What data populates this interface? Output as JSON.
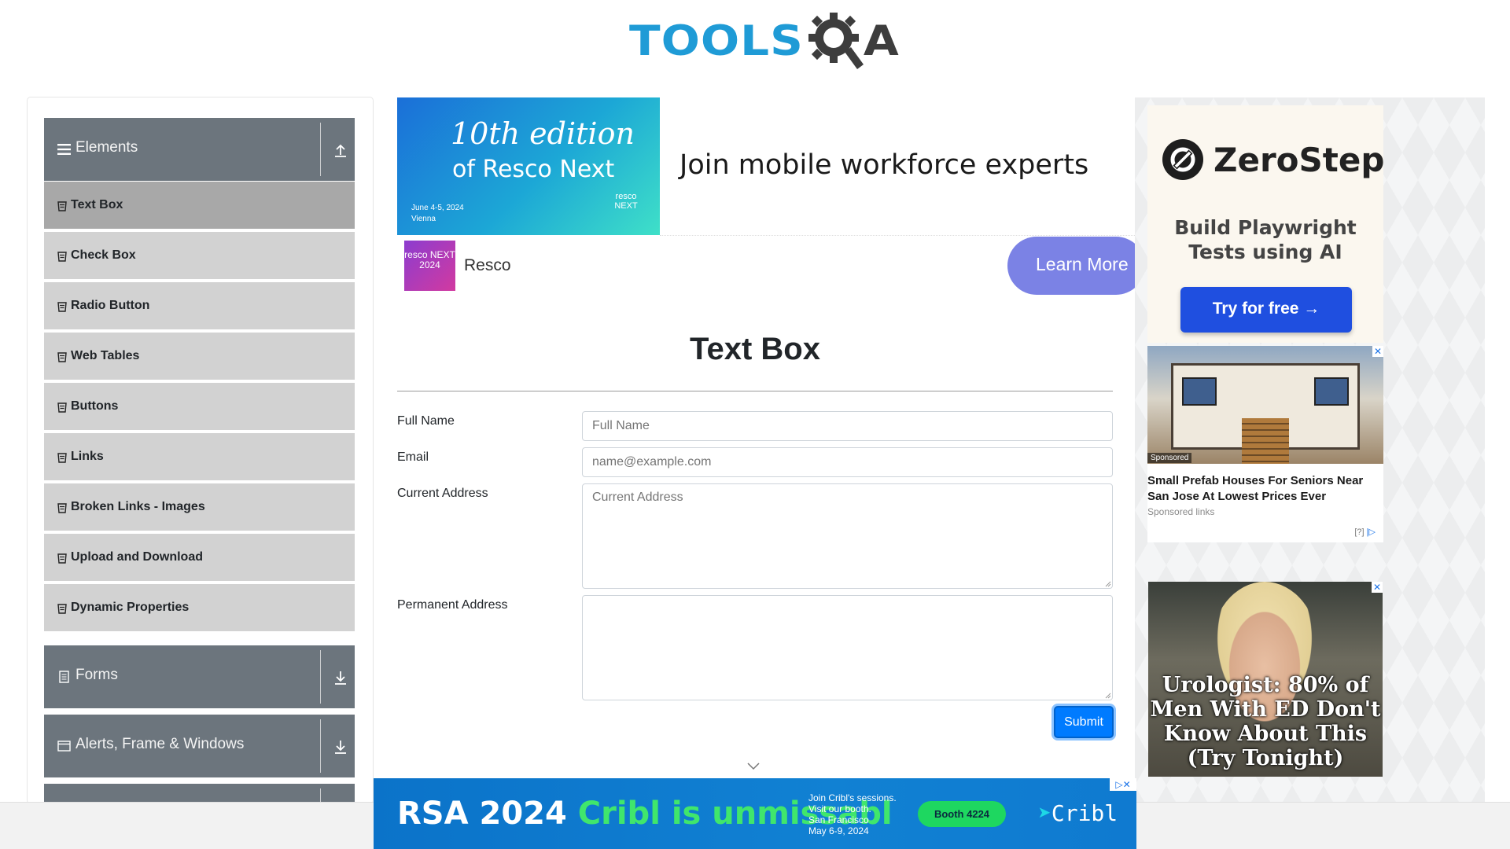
{
  "logo": {
    "part1": "TOOLS",
    "part2": "A",
    "alt": "TOOLSQA"
  },
  "sidebar": {
    "groups": [
      {
        "label": "Elements",
        "toggle": "collapse",
        "expanded": true
      },
      {
        "label": "Forms",
        "toggle": "expand"
      },
      {
        "label": "Alerts, Frame & Windows",
        "toggle": "expand"
      }
    ],
    "items": [
      {
        "label": "Text Box",
        "active": true
      },
      {
        "label": "Check Box"
      },
      {
        "label": "Radio Button"
      },
      {
        "label": "Web Tables"
      },
      {
        "label": "Buttons"
      },
      {
        "label": "Links"
      },
      {
        "label": "Broken Links - Images"
      },
      {
        "label": "Upload and Download"
      },
      {
        "label": "Dynamic Properties"
      }
    ]
  },
  "top_ad": {
    "banner_line1": "10th edition",
    "banner_line2": "of Resco Next",
    "banner_date": "June 4-5, 2024",
    "banner_city": "Vienna",
    "banner_logo": "resco NEXT",
    "headline": "Join mobile workforce experts",
    "advertiser_logo": "resco NEXT 2024",
    "advertiser": "Resco",
    "cta": "Learn More"
  },
  "form": {
    "title": "Text Box",
    "fields": [
      {
        "label": "Full Name",
        "placeholder": "Full Name",
        "value": ""
      },
      {
        "label": "Email",
        "placeholder": "name@example.com",
        "value": ""
      },
      {
        "label": "Current Address",
        "placeholder": "Current Address",
        "value": ""
      },
      {
        "label": "Permanent Address",
        "placeholder": "",
        "value": ""
      }
    ],
    "submit": "Submit"
  },
  "right_ads": {
    "zerostep": {
      "name": "ZeroStep",
      "tagline_line1": "Build Playwright",
      "tagline_line2": "Tests using AI",
      "cta": "Try for free →"
    },
    "sponsored": {
      "badge": "Sponsored",
      "title": "Small Prefab Houses For Seniors Near San Jose At Lowest Prices Ever",
      "subtitle": "Sponsored links",
      "choices": "[?]",
      "close": "✕"
    },
    "urologist": {
      "text": "Urologist: 80% of Men With ED Don't Know About This (Try Tonight)",
      "close": "✕"
    }
  },
  "bottom_ad": {
    "lead": "RSA 2024",
    "highlight": "Cribl is unmissabl",
    "info_lines": [
      "Join Cribl's sessions.",
      "Visit our booth.",
      "San Francisco",
      "May 6-9, 2024"
    ],
    "booth": "Booth 4224",
    "brand": "Cribl",
    "close": "▷✕"
  },
  "colors": {
    "sidebar_group": "#6c757d",
    "sidebar_item": "#d2d2d2",
    "sidebar_item_active": "#a8a8a8",
    "submit": "#007bff",
    "logo_blue": "#1f9bd6"
  }
}
